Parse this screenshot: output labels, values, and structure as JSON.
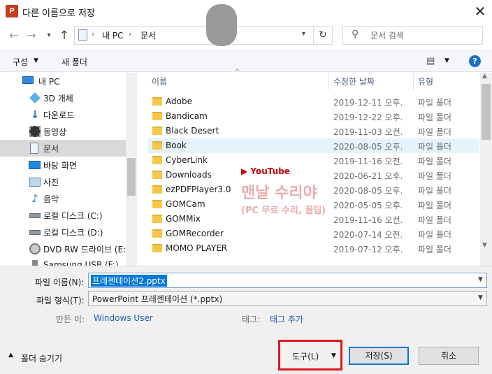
{
  "window": {
    "title": "다른 이름으로 저장",
    "app_icon": "powerpoint-icon",
    "app_icon_letter": "P",
    "close": "✕"
  },
  "address": {
    "sep": "›",
    "segments": [
      "내 PC",
      "문서"
    ],
    "search_placeholder": "문서 검색"
  },
  "toolbar": {
    "organize": "구성",
    "new_folder": "새 폴더"
  },
  "nav": {
    "items": [
      {
        "label": "내 PC",
        "icon": "pc-icon"
      },
      {
        "label": "3D 개체",
        "icon": "3d-objects-icon"
      },
      {
        "label": "다운로드",
        "icon": "download-icon"
      },
      {
        "label": "동영상",
        "icon": "video-icon"
      },
      {
        "label": "문서",
        "icon": "document-icon"
      },
      {
        "label": "바탕 화면",
        "icon": "desktop-icon"
      },
      {
        "label": "사진",
        "icon": "pictures-icon"
      },
      {
        "label": "음악",
        "icon": "music-icon"
      },
      {
        "label": "로컬 디스크 (C:)",
        "icon": "drive-icon"
      },
      {
        "label": "로컬 디스크 (D:)",
        "icon": "drive-icon"
      },
      {
        "label": "DVD RW 드라이브 (E:",
        "icon": "dvd-icon"
      },
      {
        "label": "Samsung USB (F:)",
        "icon": "usb-icon"
      }
    ]
  },
  "columns": {
    "name": "이름",
    "date": "수정한 날짜",
    "type": "유형"
  },
  "files": [
    {
      "name": "Adobe",
      "date": "2019-12-11 오후...",
      "type": "파일 폴더"
    },
    {
      "name": "Bandicam",
      "date": "2019-12-22 오후...",
      "type": "파일 폴더"
    },
    {
      "name": "Black Desert",
      "date": "2019-11-03 오전...",
      "type": "파일 폴더"
    },
    {
      "name": "Book",
      "date": "2020-08-05 오후...",
      "type": "파일 폴더"
    },
    {
      "name": "CyberLink",
      "date": "2019-11-16 오전...",
      "type": "파일 폴더"
    },
    {
      "name": "Downloads",
      "date": "2020-06-21 오후...",
      "type": "파일 폴더"
    },
    {
      "name": "ezPDFPlayer3.0",
      "date": "2020-08-05 오후...",
      "type": "파일 폴더"
    },
    {
      "name": "GOMCam",
      "date": "2020-05-05 오후...",
      "type": "파일 폴더"
    },
    {
      "name": "GOMMix",
      "date": "2019-11-16 오전...",
      "type": "파일 폴더"
    },
    {
      "name": "GOMRecorder",
      "date": "2020-07-14 오전...",
      "type": "파일 폴더"
    },
    {
      "name": "MOMO PLAYER",
      "date": "2019-07-12 오후...",
      "type": "파일 폴더"
    }
  ],
  "watermark": {
    "channel": "▶ YouTube",
    "name": "맨날 수리야",
    "sub": "(PC 무료 수리, 꿀팁)"
  },
  "form": {
    "filename_label": "파일 이름(N):",
    "filename_value": "프레젠테이션2.pptx",
    "filetype_label": "파일 형식(T):",
    "filetype_value": "PowerPoint 프레젠테이션 (*.pptx)",
    "author_label": "만든 이:",
    "author_value": "Windows User",
    "tags_label": "태그:",
    "tags_value": "태그 추가"
  },
  "footer": {
    "hide_folders": "폴더 숨기기",
    "tools": "도구(L)",
    "save": "저장(S)",
    "cancel": "취소"
  }
}
